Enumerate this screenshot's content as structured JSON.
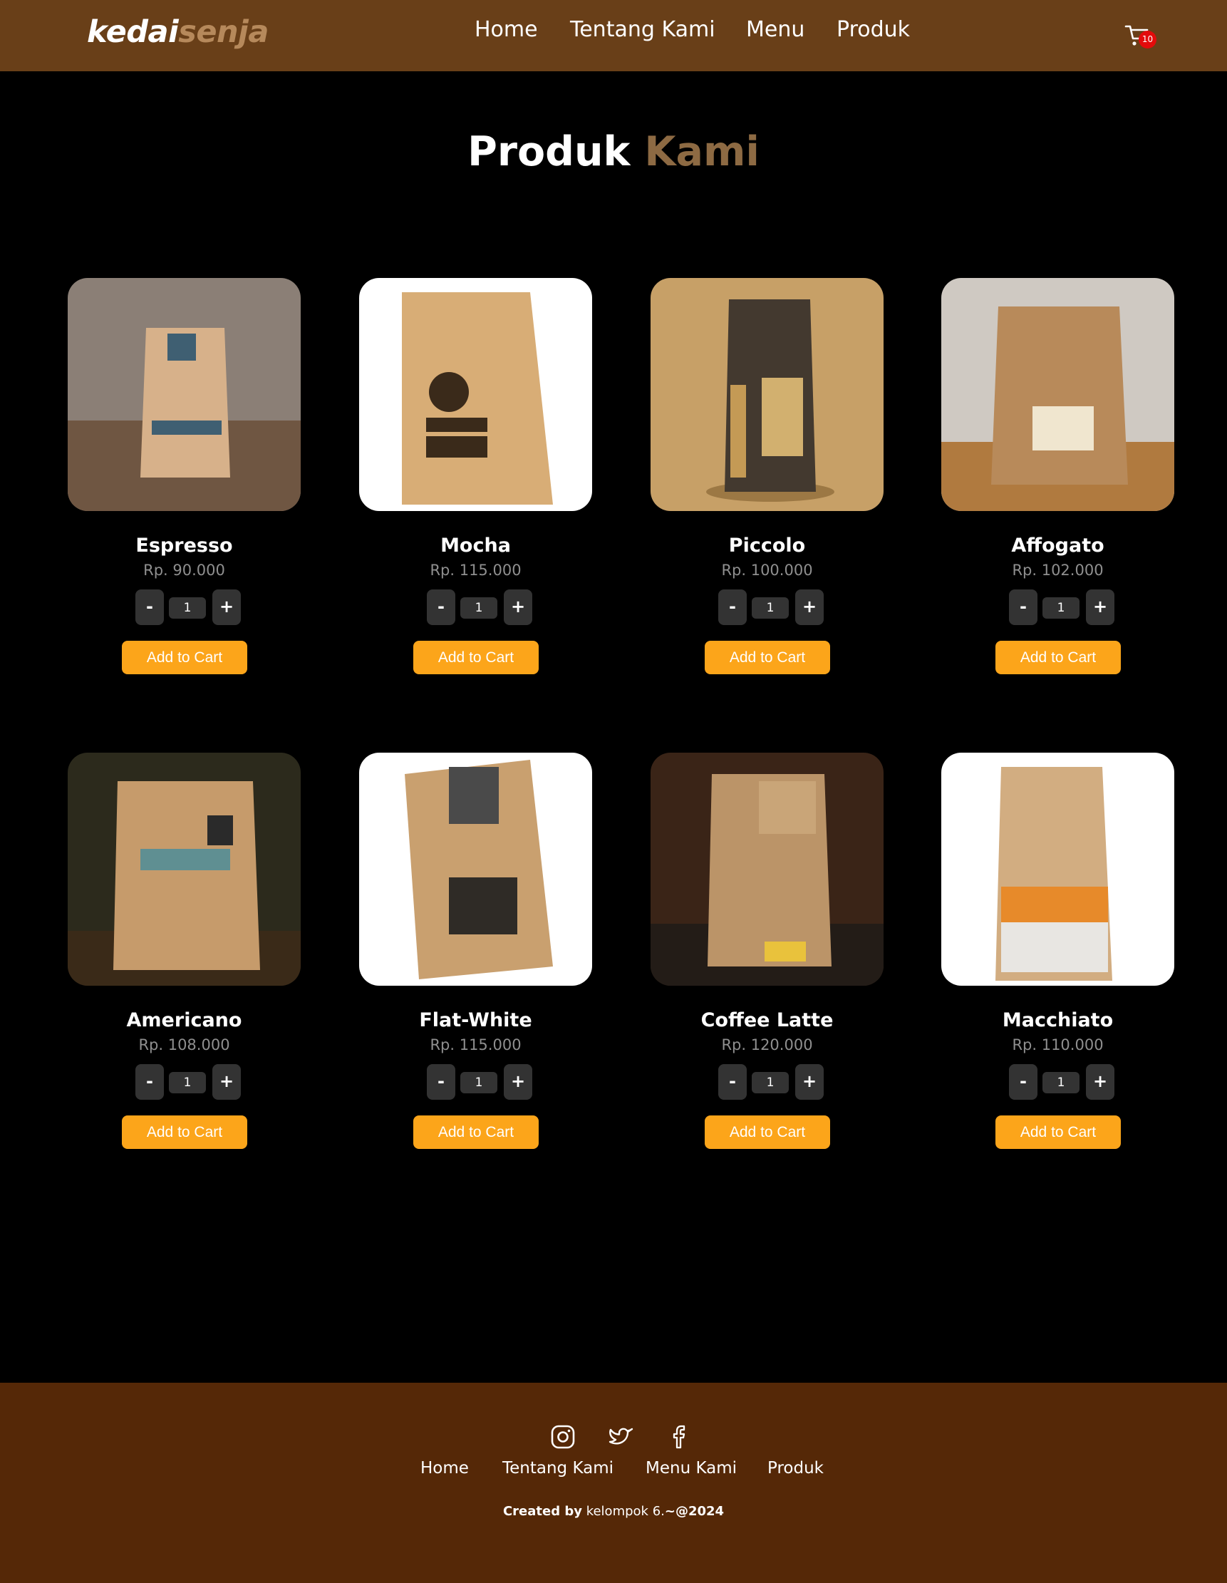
{
  "navbar": {
    "logo_part1": "kedai",
    "logo_part2": "senja",
    "links": [
      "Home",
      "Tentang Kami",
      "Menu",
      "Produk"
    ],
    "cart_icon": "cart-icon",
    "cart_count": "10"
  },
  "title": {
    "part1": "Produk",
    "part2": "Kami"
  },
  "products": [
    {
      "name": "Espresso",
      "price": "Rp. 90.000",
      "qty": "1",
      "minus": "-",
      "plus": "+",
      "button": "Add to Cart",
      "image": "coffee-bag-image"
    },
    {
      "name": "Mocha",
      "price": "Rp. 115.000",
      "qty": "1",
      "minus": "-",
      "plus": "+",
      "button": "Add to Cart",
      "image": "coffee-bag-image"
    },
    {
      "name": "Piccolo",
      "price": "Rp. 100.000",
      "qty": "1",
      "minus": "-",
      "plus": "+",
      "button": "Add to Cart",
      "image": "coffee-bag-image"
    },
    {
      "name": "Affogato",
      "price": "Rp. 102.000",
      "qty": "1",
      "minus": "-",
      "plus": "+",
      "button": "Add to Cart",
      "image": "coffee-bag-image"
    },
    {
      "name": "Americano",
      "price": "Rp. 108.000",
      "qty": "1",
      "minus": "-",
      "plus": "+",
      "button": "Add to Cart",
      "image": "coffee-bag-image"
    },
    {
      "name": "Flat-White",
      "price": "Rp. 115.000",
      "qty": "1",
      "minus": "-",
      "plus": "+",
      "button": "Add to Cart",
      "image": "coffee-bag-image"
    },
    {
      "name": "Coffee Latte",
      "price": "Rp. 120.000",
      "qty": "1",
      "minus": "-",
      "plus": "+",
      "button": "Add to Cart",
      "image": "coffee-bag-image"
    },
    {
      "name": "Macchiato",
      "price": "Rp. 110.000",
      "qty": "1",
      "minus": "-",
      "plus": "+",
      "button": "Add to Cart",
      "image": "coffee-bag-image"
    }
  ],
  "footer": {
    "social_icons": [
      "instagram-icon",
      "twitter-icon",
      "facebook-icon"
    ],
    "links": [
      "Home",
      "Tentang Kami",
      "Menu Kami",
      "Produk"
    ],
    "credit_bold": "Created by",
    "credit_name": "kelompok 6.",
    "credit_year": "~@2024"
  },
  "colors": {
    "navbar": "#693f18",
    "footer": "#552807",
    "accent": "#b6895b",
    "button": "#fca51a",
    "badge": "#e30b0b"
  }
}
